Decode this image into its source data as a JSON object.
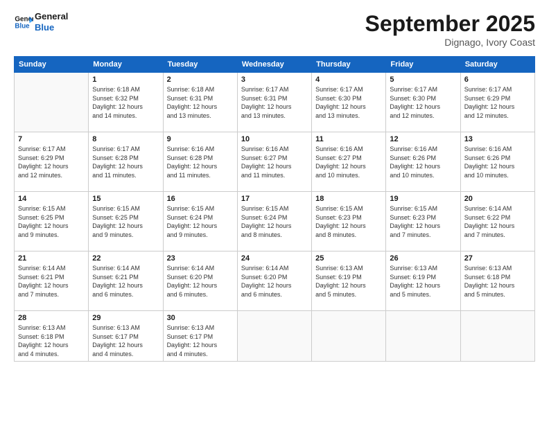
{
  "logo": {
    "line1": "General",
    "line2": "Blue"
  },
  "header": {
    "month": "September 2025",
    "location": "Dignago, Ivory Coast"
  },
  "weekdays": [
    "Sunday",
    "Monday",
    "Tuesday",
    "Wednesday",
    "Thursday",
    "Friday",
    "Saturday"
  ],
  "weeks": [
    [
      {
        "day": "",
        "info": ""
      },
      {
        "day": "1",
        "info": "Sunrise: 6:18 AM\nSunset: 6:32 PM\nDaylight: 12 hours\nand 14 minutes."
      },
      {
        "day": "2",
        "info": "Sunrise: 6:18 AM\nSunset: 6:31 PM\nDaylight: 12 hours\nand 13 minutes."
      },
      {
        "day": "3",
        "info": "Sunrise: 6:17 AM\nSunset: 6:31 PM\nDaylight: 12 hours\nand 13 minutes."
      },
      {
        "day": "4",
        "info": "Sunrise: 6:17 AM\nSunset: 6:30 PM\nDaylight: 12 hours\nand 13 minutes."
      },
      {
        "day": "5",
        "info": "Sunrise: 6:17 AM\nSunset: 6:30 PM\nDaylight: 12 hours\nand 12 minutes."
      },
      {
        "day": "6",
        "info": "Sunrise: 6:17 AM\nSunset: 6:29 PM\nDaylight: 12 hours\nand 12 minutes."
      }
    ],
    [
      {
        "day": "7",
        "info": "Sunrise: 6:17 AM\nSunset: 6:29 PM\nDaylight: 12 hours\nand 12 minutes."
      },
      {
        "day": "8",
        "info": "Sunrise: 6:17 AM\nSunset: 6:28 PM\nDaylight: 12 hours\nand 11 minutes."
      },
      {
        "day": "9",
        "info": "Sunrise: 6:16 AM\nSunset: 6:28 PM\nDaylight: 12 hours\nand 11 minutes."
      },
      {
        "day": "10",
        "info": "Sunrise: 6:16 AM\nSunset: 6:27 PM\nDaylight: 12 hours\nand 11 minutes."
      },
      {
        "day": "11",
        "info": "Sunrise: 6:16 AM\nSunset: 6:27 PM\nDaylight: 12 hours\nand 10 minutes."
      },
      {
        "day": "12",
        "info": "Sunrise: 6:16 AM\nSunset: 6:26 PM\nDaylight: 12 hours\nand 10 minutes."
      },
      {
        "day": "13",
        "info": "Sunrise: 6:16 AM\nSunset: 6:26 PM\nDaylight: 12 hours\nand 10 minutes."
      }
    ],
    [
      {
        "day": "14",
        "info": "Sunrise: 6:15 AM\nSunset: 6:25 PM\nDaylight: 12 hours\nand 9 minutes."
      },
      {
        "day": "15",
        "info": "Sunrise: 6:15 AM\nSunset: 6:25 PM\nDaylight: 12 hours\nand 9 minutes."
      },
      {
        "day": "16",
        "info": "Sunrise: 6:15 AM\nSunset: 6:24 PM\nDaylight: 12 hours\nand 9 minutes."
      },
      {
        "day": "17",
        "info": "Sunrise: 6:15 AM\nSunset: 6:24 PM\nDaylight: 12 hours\nand 8 minutes."
      },
      {
        "day": "18",
        "info": "Sunrise: 6:15 AM\nSunset: 6:23 PM\nDaylight: 12 hours\nand 8 minutes."
      },
      {
        "day": "19",
        "info": "Sunrise: 6:15 AM\nSunset: 6:23 PM\nDaylight: 12 hours\nand 7 minutes."
      },
      {
        "day": "20",
        "info": "Sunrise: 6:14 AM\nSunset: 6:22 PM\nDaylight: 12 hours\nand 7 minutes."
      }
    ],
    [
      {
        "day": "21",
        "info": "Sunrise: 6:14 AM\nSunset: 6:21 PM\nDaylight: 12 hours\nand 7 minutes."
      },
      {
        "day": "22",
        "info": "Sunrise: 6:14 AM\nSunset: 6:21 PM\nDaylight: 12 hours\nand 6 minutes."
      },
      {
        "day": "23",
        "info": "Sunrise: 6:14 AM\nSunset: 6:20 PM\nDaylight: 12 hours\nand 6 minutes."
      },
      {
        "day": "24",
        "info": "Sunrise: 6:14 AM\nSunset: 6:20 PM\nDaylight: 12 hours\nand 6 minutes."
      },
      {
        "day": "25",
        "info": "Sunrise: 6:13 AM\nSunset: 6:19 PM\nDaylight: 12 hours\nand 5 minutes."
      },
      {
        "day": "26",
        "info": "Sunrise: 6:13 AM\nSunset: 6:19 PM\nDaylight: 12 hours\nand 5 minutes."
      },
      {
        "day": "27",
        "info": "Sunrise: 6:13 AM\nSunset: 6:18 PM\nDaylight: 12 hours\nand 5 minutes."
      }
    ],
    [
      {
        "day": "28",
        "info": "Sunrise: 6:13 AM\nSunset: 6:18 PM\nDaylight: 12 hours\nand 4 minutes."
      },
      {
        "day": "29",
        "info": "Sunrise: 6:13 AM\nSunset: 6:17 PM\nDaylight: 12 hours\nand 4 minutes."
      },
      {
        "day": "30",
        "info": "Sunrise: 6:13 AM\nSunset: 6:17 PM\nDaylight: 12 hours\nand 4 minutes."
      },
      {
        "day": "",
        "info": ""
      },
      {
        "day": "",
        "info": ""
      },
      {
        "day": "",
        "info": ""
      },
      {
        "day": "",
        "info": ""
      }
    ]
  ]
}
